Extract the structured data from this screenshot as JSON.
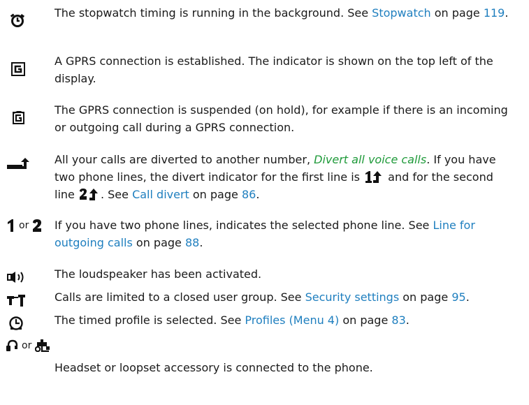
{
  "entries": [
    {
      "icon": "stopwatch-icon",
      "text": [
        "The stopwatch timing is running in the background. See ",
        "Stopwatch",
        " on page ",
        "119",
        "."
      ]
    },
    {
      "icon": "gprs-icon",
      "text": [
        "A GPRS connection is established. The indicator is shown on the top left of the display."
      ]
    },
    {
      "icon": "gprs-suspended-icon",
      "text": [
        "The GPRS connection is suspended (on hold), for example if there is an incoming or outgoing call during a GPRS connection."
      ]
    },
    {
      "icon": "call-divert-icon",
      "text_a": "All your calls are diverted to another number, ",
      "text_b": "Divert all voice calls",
      "text_c": ". If you have two phone lines, the divert indicator for the first line is ",
      "text_d": " and for the second line ",
      "text_e": ". See ",
      "link": "Call divert",
      "text_f": " on page ",
      "page": "86",
      "text_g": "."
    },
    {
      "icon": "line-select-icons",
      "or": "or",
      "text": [
        "If you have two phone lines, indicates the selected phone line. See ",
        "Line for outgoing calls",
        " on page ",
        "88",
        "."
      ]
    },
    {
      "icon": "loudspeaker-icon",
      "text": [
        "The loudspeaker has been activated."
      ]
    },
    {
      "icon": "closed-user-group-icon",
      "text": [
        "Calls are limited to a closed user group. See ",
        "Security settings",
        " on page ",
        "95",
        "."
      ]
    },
    {
      "icon": "timed-profile-icon",
      "text": [
        "The timed profile is selected. See ",
        "Profiles (Menu 4)",
        " on page ",
        "83",
        "."
      ]
    },
    {
      "icon": "headset-loopset-icons",
      "or": "or",
      "text": [
        "Headset or loopset accessory is connected to the phone."
      ]
    }
  ]
}
